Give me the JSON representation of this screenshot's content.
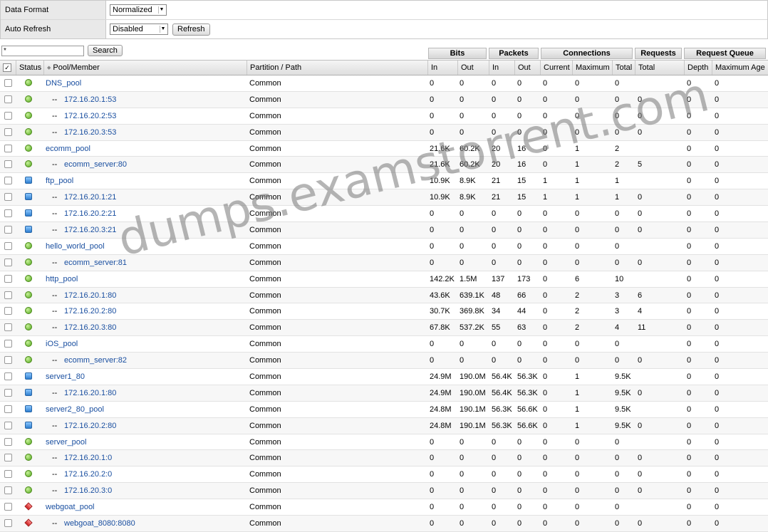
{
  "controls": {
    "data_format_label": "Data Format",
    "data_format_value": "Normalized",
    "auto_refresh_label": "Auto Refresh",
    "auto_refresh_value": "Disabled",
    "refresh_button": "Refresh"
  },
  "search": {
    "value": "*",
    "button": "Search"
  },
  "groups": {
    "bits": "Bits",
    "packets": "Packets",
    "connections": "Connections",
    "requests": "Requests",
    "request_queue": "Request Queue"
  },
  "columns": {
    "status": "Status",
    "pool_member": "Pool/Member",
    "partition": "Partition / Path",
    "bits_in": "In",
    "bits_out": "Out",
    "packets_in": "In",
    "packets_out": "Out",
    "conn_current": "Current",
    "conn_maximum": "Maximum",
    "conn_total": "Total",
    "req_total": "Total",
    "q_depth": "Depth",
    "q_max_age": "Maximum Age"
  },
  "rows": [
    {
      "name": "DNS_pool",
      "member": false,
      "status": "green",
      "partition": "Common",
      "bi": "0",
      "bo": "0",
      "pi": "0",
      "po": "0",
      "cc": "0",
      "cm": "0",
      "ct": "0",
      "rt": "",
      "qd": "0",
      "qa": "0"
    },
    {
      "name": "172.16.20.1:53",
      "member": true,
      "status": "green",
      "partition": "Common",
      "bi": "0",
      "bo": "0",
      "pi": "0",
      "po": "0",
      "cc": "0",
      "cm": "0",
      "ct": "0",
      "rt": "0",
      "qd": "0",
      "qa": "0"
    },
    {
      "name": "172.16.20.2:53",
      "member": true,
      "status": "green",
      "partition": "Common",
      "bi": "0",
      "bo": "0",
      "pi": "0",
      "po": "0",
      "cc": "0",
      "cm": "0",
      "ct": "0",
      "rt": "0",
      "qd": "0",
      "qa": "0"
    },
    {
      "name": "172.16.20.3:53",
      "member": true,
      "status": "green",
      "partition": "Common",
      "bi": "0",
      "bo": "0",
      "pi": "0",
      "po": "0",
      "cc": "0",
      "cm": "0",
      "ct": "0",
      "rt": "0",
      "qd": "0",
      "qa": "0"
    },
    {
      "name": "ecomm_pool",
      "member": false,
      "status": "green",
      "partition": "Common",
      "bi": "21.6K",
      "bo": "60.2K",
      "pi": "20",
      "po": "16",
      "cc": "0",
      "cm": "1",
      "ct": "2",
      "rt": "",
      "qd": "0",
      "qa": "0"
    },
    {
      "name": "ecomm_server:80",
      "member": true,
      "status": "green",
      "partition": "Common",
      "bi": "21.6K",
      "bo": "60.2K",
      "pi": "20",
      "po": "16",
      "cc": "0",
      "cm": "1",
      "ct": "2",
      "rt": "5",
      "qd": "0",
      "qa": "0"
    },
    {
      "name": "ftp_pool",
      "member": false,
      "status": "blue",
      "partition": "Common",
      "bi": "10.9K",
      "bo": "8.9K",
      "pi": "21",
      "po": "15",
      "cc": "1",
      "cm": "1",
      "ct": "1",
      "rt": "",
      "qd": "0",
      "qa": "0"
    },
    {
      "name": "172.16.20.1:21",
      "member": true,
      "status": "blue",
      "partition": "Common",
      "bi": "10.9K",
      "bo": "8.9K",
      "pi": "21",
      "po": "15",
      "cc": "1",
      "cm": "1",
      "ct": "1",
      "rt": "0",
      "qd": "0",
      "qa": "0"
    },
    {
      "name": "172.16.20.2:21",
      "member": true,
      "status": "blue",
      "partition": "Common",
      "bi": "0",
      "bo": "0",
      "pi": "0",
      "po": "0",
      "cc": "0",
      "cm": "0",
      "ct": "0",
      "rt": "0",
      "qd": "0",
      "qa": "0"
    },
    {
      "name": "172.16.20.3:21",
      "member": true,
      "status": "blue",
      "partition": "Common",
      "bi": "0",
      "bo": "0",
      "pi": "0",
      "po": "0",
      "cc": "0",
      "cm": "0",
      "ct": "0",
      "rt": "0",
      "qd": "0",
      "qa": "0"
    },
    {
      "name": "hello_world_pool",
      "member": false,
      "status": "green",
      "partition": "Common",
      "bi": "0",
      "bo": "0",
      "pi": "0",
      "po": "0",
      "cc": "0",
      "cm": "0",
      "ct": "0",
      "rt": "",
      "qd": "0",
      "qa": "0"
    },
    {
      "name": "ecomm_server:81",
      "member": true,
      "status": "green",
      "partition": "Common",
      "bi": "0",
      "bo": "0",
      "pi": "0",
      "po": "0",
      "cc": "0",
      "cm": "0",
      "ct": "0",
      "rt": "0",
      "qd": "0",
      "qa": "0"
    },
    {
      "name": "http_pool",
      "member": false,
      "status": "green",
      "partition": "Common",
      "bi": "142.2K",
      "bo": "1.5M",
      "pi": "137",
      "po": "173",
      "cc": "0",
      "cm": "6",
      "ct": "10",
      "rt": "",
      "qd": "0",
      "qa": "0"
    },
    {
      "name": "172.16.20.1:80",
      "member": true,
      "status": "green",
      "partition": "Common",
      "bi": "43.6K",
      "bo": "639.1K",
      "pi": "48",
      "po": "66",
      "cc": "0",
      "cm": "2",
      "ct": "3",
      "rt": "6",
      "qd": "0",
      "qa": "0"
    },
    {
      "name": "172.16.20.2:80",
      "member": true,
      "status": "green",
      "partition": "Common",
      "bi": "30.7K",
      "bo": "369.8K",
      "pi": "34",
      "po": "44",
      "cc": "0",
      "cm": "2",
      "ct": "3",
      "rt": "4",
      "qd": "0",
      "qa": "0"
    },
    {
      "name": "172.16.20.3:80",
      "member": true,
      "status": "green",
      "partition": "Common",
      "bi": "67.8K",
      "bo": "537.2K",
      "pi": "55",
      "po": "63",
      "cc": "0",
      "cm": "2",
      "ct": "4",
      "rt": "11",
      "qd": "0",
      "qa": "0"
    },
    {
      "name": "iOS_pool",
      "member": false,
      "status": "green",
      "partition": "Common",
      "bi": "0",
      "bo": "0",
      "pi": "0",
      "po": "0",
      "cc": "0",
      "cm": "0",
      "ct": "0",
      "rt": "",
      "qd": "0",
      "qa": "0"
    },
    {
      "name": "ecomm_server:82",
      "member": true,
      "status": "green",
      "partition": "Common",
      "bi": "0",
      "bo": "0",
      "pi": "0",
      "po": "0",
      "cc": "0",
      "cm": "0",
      "ct": "0",
      "rt": "0",
      "qd": "0",
      "qa": "0"
    },
    {
      "name": "server1_80",
      "member": false,
      "status": "blue",
      "partition": "Common",
      "bi": "24.9M",
      "bo": "190.0M",
      "pi": "56.4K",
      "po": "56.3K",
      "cc": "0",
      "cm": "1",
      "ct": "9.5K",
      "rt": "",
      "qd": "0",
      "qa": "0"
    },
    {
      "name": "172.16.20.1:80",
      "member": true,
      "status": "blue",
      "partition": "Common",
      "bi": "24.9M",
      "bo": "190.0M",
      "pi": "56.4K",
      "po": "56.3K",
      "cc": "0",
      "cm": "1",
      "ct": "9.5K",
      "rt": "0",
      "qd": "0",
      "qa": "0"
    },
    {
      "name": "server2_80_pool",
      "member": false,
      "status": "blue",
      "partition": "Common",
      "bi": "24.8M",
      "bo": "190.1M",
      "pi": "56.3K",
      "po": "56.6K",
      "cc": "0",
      "cm": "1",
      "ct": "9.5K",
      "rt": "",
      "qd": "0",
      "qa": "0"
    },
    {
      "name": "172.16.20.2:80",
      "member": true,
      "status": "blue",
      "partition": "Common",
      "bi": "24.8M",
      "bo": "190.1M",
      "pi": "56.3K",
      "po": "56.6K",
      "cc": "0",
      "cm": "1",
      "ct": "9.5K",
      "rt": "0",
      "qd": "0",
      "qa": "0"
    },
    {
      "name": "server_pool",
      "member": false,
      "status": "green",
      "partition": "Common",
      "bi": "0",
      "bo": "0",
      "pi": "0",
      "po": "0",
      "cc": "0",
      "cm": "0",
      "ct": "0",
      "rt": "",
      "qd": "0",
      "qa": "0"
    },
    {
      "name": "172.16.20.1:0",
      "member": true,
      "status": "green",
      "partition": "Common",
      "bi": "0",
      "bo": "0",
      "pi": "0",
      "po": "0",
      "cc": "0",
      "cm": "0",
      "ct": "0",
      "rt": "0",
      "qd": "0",
      "qa": "0"
    },
    {
      "name": "172.16.20.2:0",
      "member": true,
      "status": "green",
      "partition": "Common",
      "bi": "0",
      "bo": "0",
      "pi": "0",
      "po": "0",
      "cc": "0",
      "cm": "0",
      "ct": "0",
      "rt": "0",
      "qd": "0",
      "qa": "0"
    },
    {
      "name": "172.16.20.3:0",
      "member": true,
      "status": "green",
      "partition": "Common",
      "bi": "0",
      "bo": "0",
      "pi": "0",
      "po": "0",
      "cc": "0",
      "cm": "0",
      "ct": "0",
      "rt": "0",
      "qd": "0",
      "qa": "0"
    },
    {
      "name": "webgoat_pool",
      "member": false,
      "status": "red",
      "partition": "Common",
      "bi": "0",
      "bo": "0",
      "pi": "0",
      "po": "0",
      "cc": "0",
      "cm": "0",
      "ct": "0",
      "rt": "",
      "qd": "0",
      "qa": "0"
    },
    {
      "name": "webgoat_8080:8080",
      "member": true,
      "status": "red",
      "partition": "Common",
      "bi": "0",
      "bo": "0",
      "pi": "0",
      "po": "0",
      "cc": "0",
      "cm": "0",
      "ct": "0",
      "rt": "0",
      "qd": "0",
      "qa": "0"
    }
  ],
  "member_prefix": "--",
  "watermark": "dumps.examstorrent.com",
  "colors": {
    "link": "#1a4fa0",
    "status_green": "#53a81e",
    "status_blue": "#2f7fd0",
    "status_red": "#cc2020"
  }
}
